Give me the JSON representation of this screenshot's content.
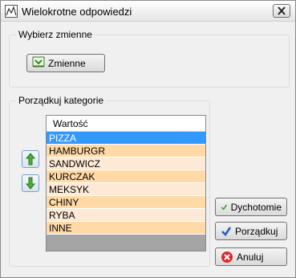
{
  "window": {
    "title": "Wielokrotne odpowiedzi"
  },
  "group_variables": {
    "legend": "Wybierz zmienne",
    "button_label": "Zmienne"
  },
  "group_order": {
    "legend": "Porządkuj kategorie",
    "column_header": "Wartość",
    "rows": [
      {
        "label": "PIZZA",
        "color": "#3399ff",
        "selected": true
      },
      {
        "label": "HAMBURGR",
        "color": "#ffd9a6"
      },
      {
        "label": "SANDWICZ",
        "color": "#fde9d6"
      },
      {
        "label": "KURCZAK",
        "color": "#ffd9a6"
      },
      {
        "label": "MEKSYK",
        "color": "#fde9d6"
      },
      {
        "label": "CHINY",
        "color": "#ffd9a6"
      },
      {
        "label": "RYBA",
        "color": "#fde9d6"
      },
      {
        "label": "INNE",
        "color": "#ffd9a6"
      }
    ]
  },
  "buttons": {
    "dichotomy": "Dychotomie",
    "order": "Porządkuj",
    "cancel": "Anuluj"
  }
}
